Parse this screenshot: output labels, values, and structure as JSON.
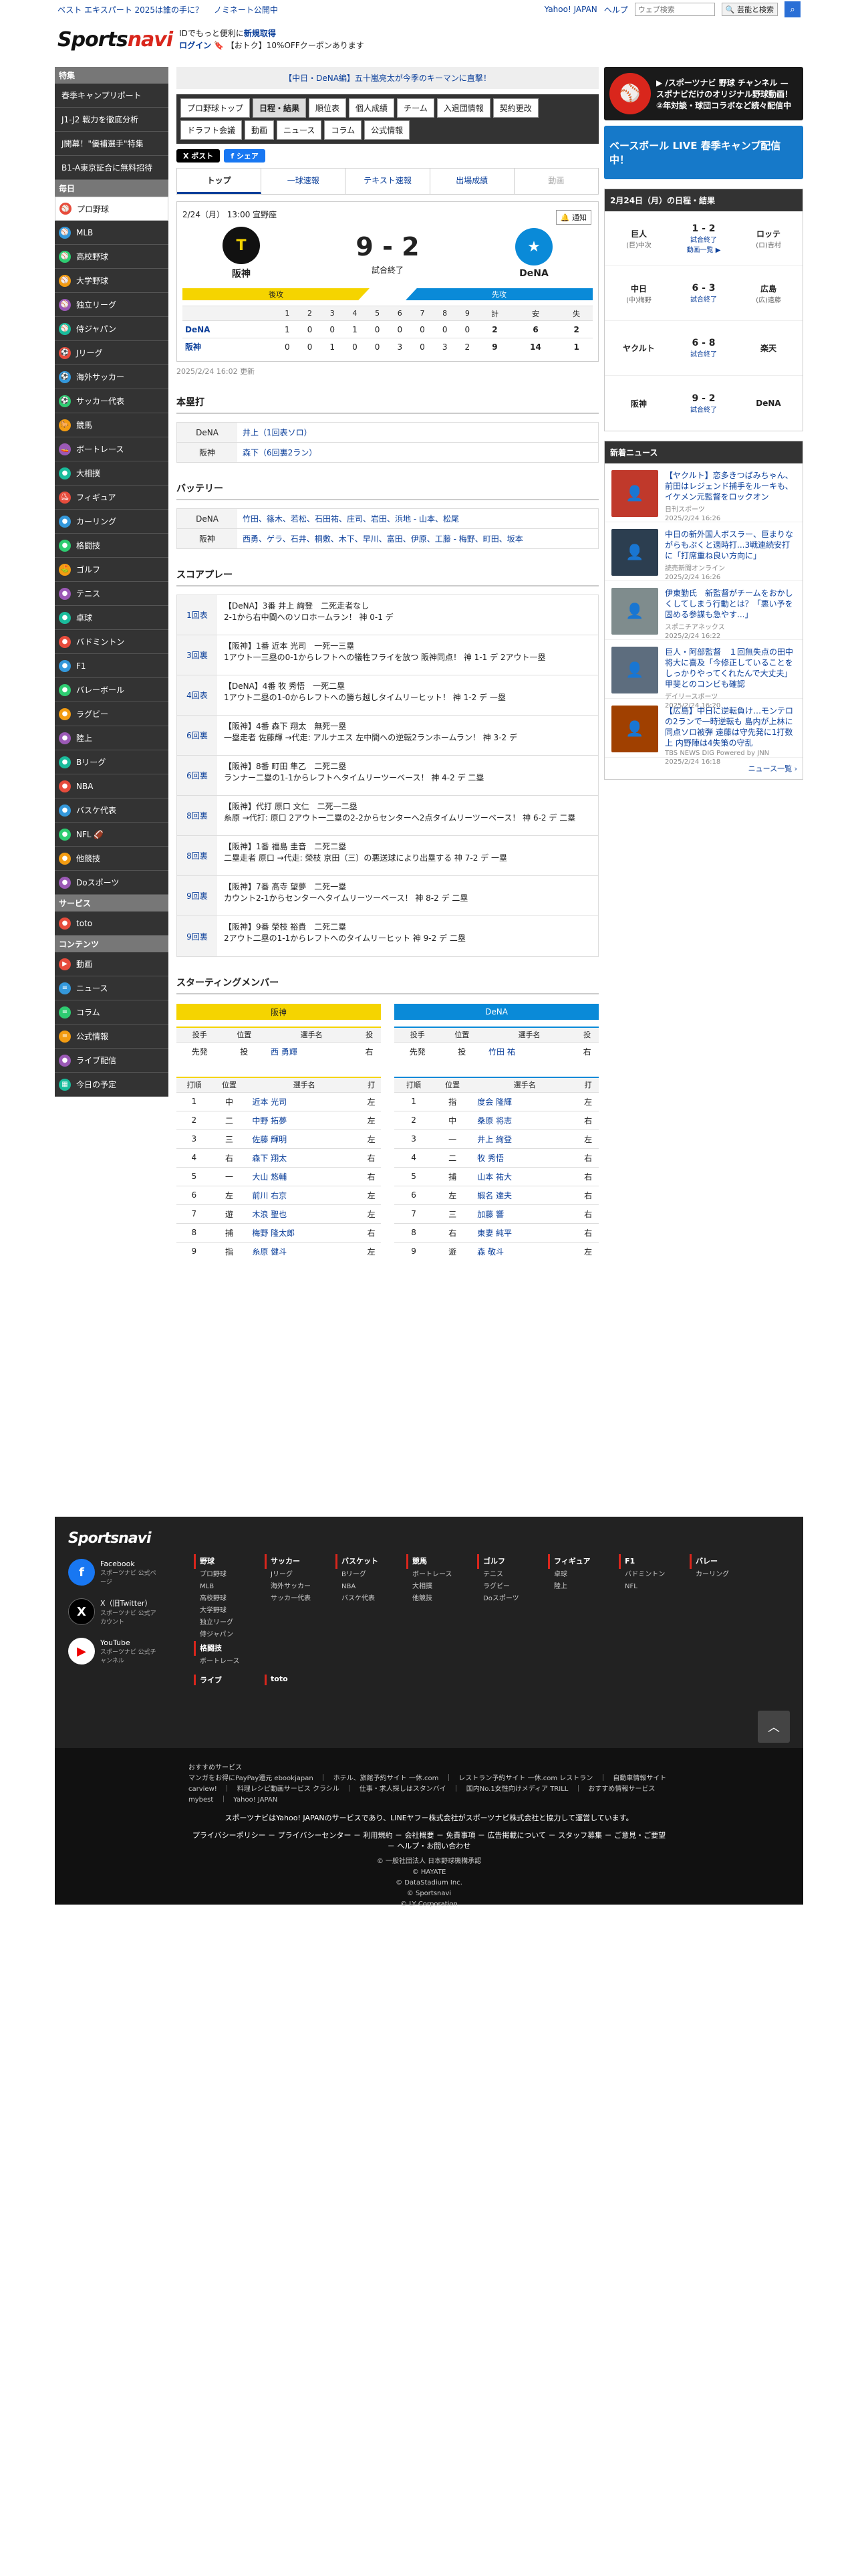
{
  "topbar": {
    "links": [
      "ベスト エキスパート 2025は誰の手に？",
      "ノミネート公開中"
    ],
    "right_links": [
      "Yahoo! JAPAN",
      "ヘルプ"
    ],
    "search_placeholder": "ウェブ検索",
    "search_button": "🔍 芸能と検索"
  },
  "header": {
    "logo_main": "Sports",
    "logo_accent": "navi",
    "line1_prefix": "IDでもっと便利に",
    "line1_link": "新規取得",
    "line2_login": "ログイン",
    "line2_text": "【おトク】10%OFFクーポンあります"
  },
  "sidebar": {
    "sections": [
      {
        "title": "特集",
        "items": [
          {
            "label": "春季キャンプリポート"
          },
          {
            "label": "J1-J2 戦力を徹底分析"
          },
          {
            "label": "J開幕！\"優補選手\"特集"
          },
          {
            "label": "B1-A東京証合に無料招待"
          }
        ]
      },
      {
        "title": "毎日",
        "items": [
          {
            "label": "プロ野球",
            "icon": "⚾",
            "active": true
          },
          {
            "label": "MLB",
            "icon": "⚾"
          },
          {
            "label": "高校野球",
            "icon": "⚾"
          },
          {
            "label": "大学野球",
            "icon": "⚾"
          },
          {
            "label": "独立リーグ",
            "icon": "⚾"
          },
          {
            "label": "侍ジャパン",
            "icon": "⚾"
          },
          {
            "label": "Jリーグ",
            "icon": "⚽"
          },
          {
            "label": "海外サッカー",
            "icon": "⚽"
          },
          {
            "label": "サッカー代表",
            "icon": "⚽"
          },
          {
            "label": "競馬",
            "icon": "🐎"
          },
          {
            "label": "ボートレース",
            "icon": "🚤"
          },
          {
            "label": "大相撲",
            "icon": "●"
          },
          {
            "label": "フィギュア",
            "icon": "⛸"
          },
          {
            "label": "カーリング",
            "icon": "●"
          },
          {
            "label": "格闘技",
            "icon": "●"
          },
          {
            "label": "ゴルフ",
            "icon": "⛳"
          },
          {
            "label": "テニス",
            "icon": "●"
          },
          {
            "label": "卓球",
            "icon": "●"
          },
          {
            "label": "バドミントン",
            "icon": "●"
          },
          {
            "label": "F1",
            "icon": "●"
          },
          {
            "label": "バレーボール",
            "icon": "●"
          },
          {
            "label": "ラグビー",
            "icon": "●"
          },
          {
            "label": "陸上",
            "icon": "●"
          },
          {
            "label": "Bリーグ",
            "icon": "●"
          },
          {
            "label": "NBA",
            "icon": "●"
          },
          {
            "label": "バスケ代表",
            "icon": "●"
          },
          {
            "label": "NFL 🏈",
            "icon": "●"
          },
          {
            "label": "他競技",
            "icon": "●"
          },
          {
            "label": "Doスポーツ",
            "icon": "●"
          }
        ]
      },
      {
        "title": "サービス",
        "items": [
          {
            "label": "toto",
            "icon": "●"
          }
        ]
      },
      {
        "title": "コンテンツ",
        "items": [
          {
            "label": "動画",
            "icon": "▶"
          },
          {
            "label": "ニュース",
            "icon": "≡"
          },
          {
            "label": "コラム",
            "icon": "≡"
          },
          {
            "label": "公式情報",
            "icon": "≡"
          },
          {
            "label": "ライブ配信",
            "icon": "●"
          },
          {
            "label": "今日の予定",
            "icon": "▦"
          }
        ]
      }
    ]
  },
  "main": {
    "notice": "【中日・DeNA編】五十嵐亮太が今季のキーマンに直撃！",
    "tabs": [
      "プロ野球トップ",
      "日程・結果",
      "順位表",
      "個人成績",
      "チーム",
      "入退団情報",
      "契約更改",
      "ドラフト会議",
      "動画",
      "ニュース",
      "コラム",
      "公式情報"
    ],
    "social": [
      "X ポスト",
      "f シェア"
    ],
    "subtabs": [
      "トップ",
      "一球速報",
      "テキスト速報",
      "出場成績",
      "動画"
    ],
    "game": {
      "date": "2/24（月） 13:00 宜野座",
      "notify": "🔔 通知",
      "home": "阪神",
      "away": "DeNA",
      "home_score": "9",
      "away_score": "2",
      "dash": "-",
      "status": "試合終了",
      "home_label": "後攻",
      "away_label": "先攻"
    },
    "linescore": {
      "headers": [
        "",
        "1",
        "2",
        "3",
        "4",
        "5",
        "6",
        "7",
        "8",
        "9",
        "計",
        "安",
        "失"
      ],
      "rows": [
        [
          "DeNA",
          "1",
          "0",
          "0",
          "1",
          "0",
          "0",
          "0",
          "0",
          "0",
          "2",
          "6",
          "2"
        ],
        [
          "阪神",
          "0",
          "0",
          "1",
          "0",
          "0",
          "3",
          "0",
          "3",
          "2",
          "9",
          "14",
          "1"
        ]
      ]
    },
    "updated": "2025/2/24 16:02 更新",
    "hr_title": "本塁打",
    "hr": [
      {
        "team": "DeNA",
        "text": "井上（1回表ソロ）"
      },
      {
        "team": "阪神",
        "text": "森下（6回裏2ラン）"
      }
    ],
    "battery_title": "バッテリー",
    "battery": [
      {
        "team": "DeNA",
        "text": "竹田、篠木、若松、石田祐、庄司、岩田、浜地 - 山本、松尾"
      },
      {
        "team": "阪神",
        "text": "西勇、ゲラ、石井、桐敷、木下、早川、富田、伊原、工藤 - 梅野、町田、坂本"
      }
    ],
    "play_title": "スコアプレー",
    "plays": [
      {
        "inn": "1回表",
        "l1": "【DeNA】3番 井上 絢登　二死走者なし",
        "l2": "2-1から右中間へのソロホームラン！ 神 0-1 デ"
      },
      {
        "inn": "3回裏",
        "l1": "【阪神】1番 近本 光司　一死一三塁",
        "l2": "1アウト一三塁の0-1からレフトへの犠牲フライを放つ 阪神同点！ 神 1-1 デ 2アウト一塁"
      },
      {
        "inn": "4回表",
        "l1": "【DeNA】4番 牧 秀悟　一死二塁",
        "l2": "1アウト二塁の1-0からレフトへの勝ち越しタイムリーヒット！ 神 1-2 デ 一塁"
      },
      {
        "inn": "6回裏",
        "l1": "【阪神】4番 森下 翔太　無死一塁",
        "l2": "一塁走者 佐藤輝 →代走: アルナエス 左中間への逆転2ランホームラン！ 神 3-2 デ"
      },
      {
        "inn": "6回裏",
        "l1": "【阪神】8番 町田 隼乙　二死二塁",
        "l2": "ランナー二塁の1-1からレフトへタイムリーツーベース！ 神 4-2 デ 二塁"
      },
      {
        "inn": "8回裏",
        "l1": "【阪神】代打 原口 文仁　二死一二塁",
        "l2": "糸原 →代打: 原口 2アウト一二塁の2-2からセンターへ2点タイムリーツーベース！ 神 6-2 デ 二塁"
      },
      {
        "inn": "8回裏",
        "l1": "【阪神】1番 福島 圭音　二死二塁",
        "l2": "二塁走者 原口 →代走: 榮枝 京田（三）の悪送球により出塁する 神 7-2 デ 一塁"
      },
      {
        "inn": "9回裏",
        "l1": "【阪神】7番 髙寺 望夢　二死一塁",
        "l2": "カウント2-1からセンターへタイムリーツーベース！ 神 8-2 デ 二塁"
      },
      {
        "inn": "9回裏",
        "l1": "【阪神】9番 榮枝 裕貴　二死二塁",
        "l2": "2アウト二塁の1-1からレフトへのタイムリーヒット 神 9-2 デ 二塁"
      }
    ],
    "starting_title": "スターティングメンバー",
    "starting": {
      "pitcher_headers": [
        "投手",
        "位置",
        "選手名",
        "投"
      ],
      "batter_headers": [
        "打順",
        "位置",
        "選手名",
        "打"
      ],
      "home": {
        "team": "阪神",
        "pitcher": [
          "先発",
          "投",
          "西 勇輝",
          "右"
        ],
        "batters": [
          [
            "1",
            "中",
            "近本 光司",
            "左"
          ],
          [
            "2",
            "二",
            "中野 拓夢",
            "左"
          ],
          [
            "3",
            "三",
            "佐藤 輝明",
            "左"
          ],
          [
            "4",
            "右",
            "森下 翔太",
            "右"
          ],
          [
            "5",
            "一",
            "大山 悠輔",
            "右"
          ],
          [
            "6",
            "左",
            "前川 右京",
            "左"
          ],
          [
            "7",
            "遊",
            "木浪 聖也",
            "左"
          ],
          [
            "8",
            "捕",
            "梅野 隆太郎",
            "右"
          ],
          [
            "9",
            "指",
            "糸原 健斗",
            "左"
          ]
        ]
      },
      "away": {
        "team": "DeNA",
        "pitcher": [
          "先発",
          "投",
          "竹田 祐",
          "右"
        ],
        "batters": [
          [
            "1",
            "指",
            "度会 隆輝",
            "左"
          ],
          [
            "2",
            "中",
            "桑原 将志",
            "右"
          ],
          [
            "3",
            "一",
            "井上 絢登",
            "左"
          ],
          [
            "4",
            "二",
            "牧 秀悟",
            "右"
          ],
          [
            "5",
            "捕",
            "山本 祐大",
            "右"
          ],
          [
            "6",
            "左",
            "蝦名 達夫",
            "右"
          ],
          [
            "7",
            "三",
            "加藤 響",
            "右"
          ],
          [
            "8",
            "右",
            "東妻 純平",
            "右"
          ],
          [
            "9",
            "遊",
            "森 敬斗",
            "左"
          ]
        ]
      }
    }
  },
  "right": {
    "banner1": "▶ /スポーツナビ 野球 チャンネル — スポナビだけのオリジナル野球動画！ ②年対談・球団コラボなど続々配信中",
    "banner2": "ベースボール LIVE 春季キャンプ配信中！",
    "results_title": "2月24日（月）の日程・結果",
    "results": [
      {
        "home": "巨人",
        "home_sub": "(巨)中次",
        "away": "ロッテ",
        "away_sub": "(ロ)吉村",
        "score": "1 - 2",
        "status": "試合終了",
        "extra": "動画一覧 ▶"
      },
      {
        "home": "中日",
        "home_sub": "(中)梅野",
        "away": "広島",
        "away_sub": "(広)遠藤",
        "score": "6 - 3",
        "status": "試合終了",
        "extra": ""
      },
      {
        "home": "ヤクルト",
        "home_sub": "",
        "away": "楽天",
        "away_sub": "",
        "score": "6 - 8",
        "status": "試合終了",
        "extra": ""
      },
      {
        "home": "阪神",
        "home_sub": "",
        "away": "DeNA",
        "away_sub": "",
        "score": "9 - 2",
        "status": "試合終了",
        "extra": ""
      }
    ],
    "news_title": "新着ニュース",
    "news": [
      {
        "title": "【ヤクルト】恋多きつばみちゃん、前田はレジェンド捕手をルーキも、イケメン元監督をロックオン",
        "src": "日刊スポーツ",
        "time": "2025/2/24 16:26"
      },
      {
        "title": "中日の新外国人ボスラー、巨まりながらもぷくと適時打...3戦連続安打に「打席重ね良い方向に」",
        "src": "読売新聞オンライン",
        "time": "2025/2/24 16:26"
      },
      {
        "title": "伊東勤氏　新監督がチームをおかしくしてしまう行動とは？「悪い予を固める参謀も急やす...」",
        "src": "スポニチアネックス",
        "time": "2025/2/24 16:22"
      },
      {
        "title": "巨人・阿部監督　１回無失点の田中将大に喜及「今修正していることをしっかりやってくれたんで大丈夫」 甲斐とのコンビも確認",
        "src": "デイリースポーツ",
        "time": "2025/2/24 16:20"
      },
      {
        "title": "【広島】中日に逆転負け…モンテロの2ランで一時逆転も 島内が上林に同点ソロ被弾 遠藤は守先発に1打数上 内野陣は4失策の守乱",
        "src": "TBS NEWS DIG Powered by JNN",
        "time": "2025/2/24 16:18"
      }
    ],
    "news_more": "ニュース一覧 ›"
  },
  "footer": {
    "logo": "Sportsnavi",
    "social": [
      {
        "name": "Facebook",
        "sub": "スポーツナビ 公式ページ"
      },
      {
        "name": "X（旧Twitter）",
        "sub": "スポーツナビ 公式アカウント"
      },
      {
        "name": "YouTube",
        "sub": "スポーツナビ 公式チャンネル"
      }
    ],
    "cols": [
      {
        "h": "野球",
        "s": [
          "プロ野球",
          "MLB",
          "高校野球",
          "大学野球",
          "独立リーグ",
          "侍ジャパン"
        ]
      },
      {
        "h": "サッカー",
        "s": [
          "Jリーグ",
          "海外サッカー",
          "サッカー代表"
        ]
      },
      {
        "h": "バスケット",
        "s": [
          "Bリーグ",
          "NBA",
          "バスケ代表"
        ]
      },
      {
        "h": "競馬",
        "s": [
          "ボートレース",
          "大相撲",
          "他競技"
        ]
      },
      {
        "h": "ゴルフ",
        "s": [
          "テニス",
          "ラグビー",
          "Doスポーツ"
        ]
      },
      {
        "h": "フィギュア",
        "s": [
          "卓球",
          "陸上"
        ]
      },
      {
        "h": "F1",
        "s": [
          "バドミントン",
          "NFL"
        ]
      },
      {
        "h": "バレー",
        "s": [
          "カーリング"
        ]
      },
      {
        "h": "格闘技",
        "s": [
          "ボートレース"
        ]
      }
    ],
    "extra": [
      "ライブ",
      "toto"
    ],
    "rec_title": "おすすめサービス",
    "rec": "マンガをお得にPayPay還元 ebookjapan　｜　ホテル、旅館予約サイト 一休.com　｜　レストラン予約サイト 一休.com レストラン　｜　自動車情報サイト carview!　｜　料理レシピ動画サービス クラシル　｜　仕事・求人探しはスタンバイ　｜　国内No.1女性向けメディア TRILL　｜　おすすめ情報サービス mybest　｜　Yahoo! JAPAN",
    "note": "スポーツナビはYahoo! JAPANのサービスであり、LINEヤフー株式会社がスポーツナビ株式会社と協力して運営しています。",
    "links": "プライバシーポリシー － プライバシーセンター － 利用規約 － 会社概要 － 免責事項 － 広告掲載について － スタッフ募集 － ご意見・ご要望 － ヘルプ・お問い合わせ",
    "copy": [
      "© 一般社団法人 日本野球機構承認",
      "© HAYATE",
      "© DataStadium Inc.",
      "© Sportsnavi",
      "© LY Corporation"
    ]
  },
  "colors": {
    "accent": "#0b3f9a",
    "tigers": "#f5d400",
    "baystars": "#0a8ad8",
    "dark": "#333333",
    "red": "#d9261c"
  }
}
